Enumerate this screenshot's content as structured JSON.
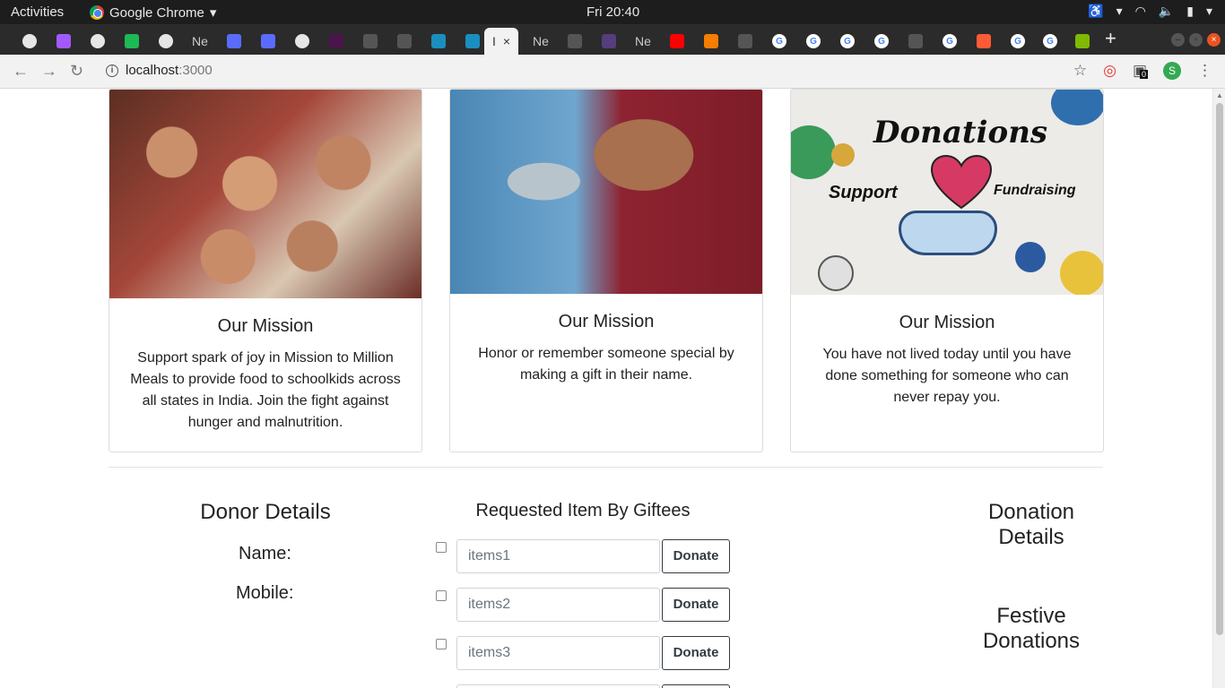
{
  "os": {
    "activities": "Activities",
    "app_name": "Google Chrome",
    "clock": "Fri 20:40"
  },
  "browser": {
    "tabs": [
      {
        "icon": "github-icon",
        "label": ""
      },
      {
        "icon": "figma-icon",
        "label": ""
      },
      {
        "icon": "github-icon",
        "label": ""
      },
      {
        "icon": "spotify-icon",
        "label": ""
      },
      {
        "icon": "github-icon",
        "label": ""
      },
      {
        "icon": "tab-icon",
        "label": "Ne"
      },
      {
        "icon": "mdn-icon",
        "label": ""
      },
      {
        "icon": "mdn-icon",
        "label": ""
      },
      {
        "icon": "github-icon",
        "label": ""
      },
      {
        "icon": "slack-icon",
        "label": ""
      },
      {
        "icon": "tab-icon",
        "label": ""
      },
      {
        "icon": "tab-icon",
        "label": ""
      },
      {
        "icon": "react-icon",
        "label": ""
      },
      {
        "icon": "react-icon",
        "label": ""
      },
      {
        "icon": "active-tab",
        "label": "I"
      },
      {
        "icon": "tab-icon",
        "label": "Ne"
      },
      {
        "icon": "tab-icon",
        "label": ""
      },
      {
        "icon": "bootstrap-icon",
        "label": ""
      },
      {
        "icon": "tab-icon",
        "label": "Ne"
      },
      {
        "icon": "youtube-icon",
        "label": ""
      },
      {
        "icon": "blogger-icon",
        "label": ""
      },
      {
        "icon": "tab-icon",
        "label": ""
      },
      {
        "icon": "google-icon",
        "label": ""
      },
      {
        "icon": "google-icon",
        "label": ""
      },
      {
        "icon": "google-icon",
        "label": ""
      },
      {
        "icon": "google-icon",
        "label": ""
      },
      {
        "icon": "tab-icon",
        "label": ""
      },
      {
        "icon": "google-icon",
        "label": ""
      },
      {
        "icon": "loading-icon",
        "label": ""
      },
      {
        "icon": "google-icon",
        "label": ""
      },
      {
        "icon": "google-icon",
        "label": ""
      },
      {
        "icon": "microsoft-icon",
        "label": ""
      }
    ],
    "url_host": "localhost",
    "url_port": ":3000",
    "extension_badge": "0",
    "profile_initial": "S"
  },
  "cards": [
    {
      "title": "Our Mission",
      "text": "Support spark of joy in Mission to Million Meals to provide food to schoolkids across all states in India. Join the fight against hunger and malnutrition."
    },
    {
      "title": "Our Mission",
      "text": "Honor or remember someone special by making a gift in their name."
    },
    {
      "title": "Our Mission",
      "text": "You have not lived today until you have done something for someone who can never repay you."
    }
  ],
  "card3_image_words": {
    "donations": "Donations",
    "support": "Support",
    "fundraising": "Fundraising"
  },
  "donor": {
    "title": "Donor Details",
    "name_label": "Name:",
    "mobile_label": "Mobile:"
  },
  "requested": {
    "title": "Requested Item By Giftees",
    "items": [
      {
        "placeholder": "items1",
        "button": "Donate"
      },
      {
        "placeholder": "items2",
        "button": "Donate"
      },
      {
        "placeholder": "items3",
        "button": "Donate"
      }
    ]
  },
  "right": {
    "donation_details_1": "Donation",
    "donation_details_2": "Details",
    "festive_1": "Festive",
    "festive_2": "Donations"
  }
}
